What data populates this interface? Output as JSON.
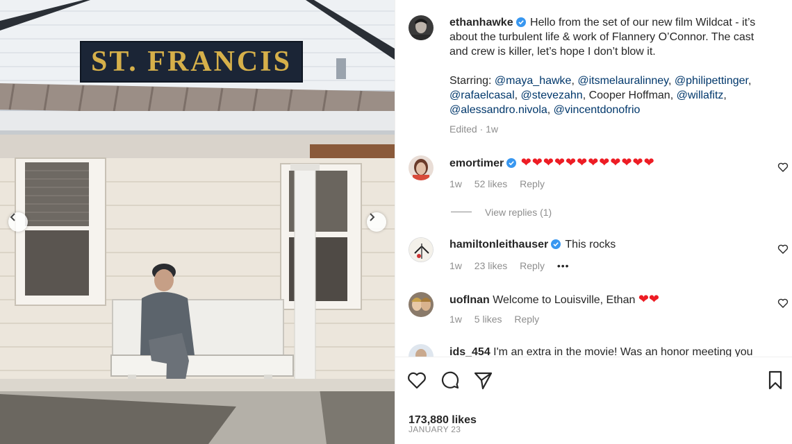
{
  "photo": {
    "sign_text": "ST. FRANCIS",
    "description_alt": "photo"
  },
  "post": {
    "author": "ethanhawke",
    "caption_lines": [
      "Hello from the set of our new film Wildcat - it’s",
      "about the turbulent life & work of Flannery O’Connor. The cast",
      "and crew is killer, let’s hope I don’t blow it."
    ],
    "starring_label": "Starring:",
    "starring_line1": [
      "@maya_hawke",
      "@itsmelauralinney",
      "@philipettinger"
    ],
    "starring_line2_mentions": [
      "@rafaelcasal",
      "@stevezahn"
    ],
    "starring_line2_plain": "Cooper Hoffman,",
    "starring_line2_tail": "@willafitz",
    "starring_line3": [
      "@alessandro.nivola",
      "@vincentdonofrio"
    ],
    "edited": "Edited · 1w"
  },
  "comments": [
    {
      "username": "emortimer",
      "verified": true,
      "text": "❤❤❤❤❤❤❤❤❤❤❤❤",
      "age": "1w",
      "likes": "52 likes",
      "reply": "Reply",
      "view_replies": "View replies (1)"
    },
    {
      "username": "hamiltonleithauser",
      "verified": true,
      "text": "This rocks",
      "age": "1w",
      "likes": "23 likes",
      "reply": "Reply",
      "more": "•••"
    },
    {
      "username": "uoflnan",
      "verified": false,
      "text": "Welcome to Louisville, Ethan",
      "hearts": "❤❤",
      "age": "1w",
      "likes": "5 likes",
      "reply": "Reply"
    },
    {
      "username": "ids_454",
      "verified": false,
      "text": "I'm an extra in the movie! Was an honor meeting you"
    }
  ],
  "actions": {
    "likes_count": "173,880 likes",
    "date": "JANUARY 23"
  },
  "colors": {
    "verified": "#3897f0",
    "heart": "#ed1c24",
    "mention": "#00376b",
    "meta": "#8e8e8e"
  }
}
